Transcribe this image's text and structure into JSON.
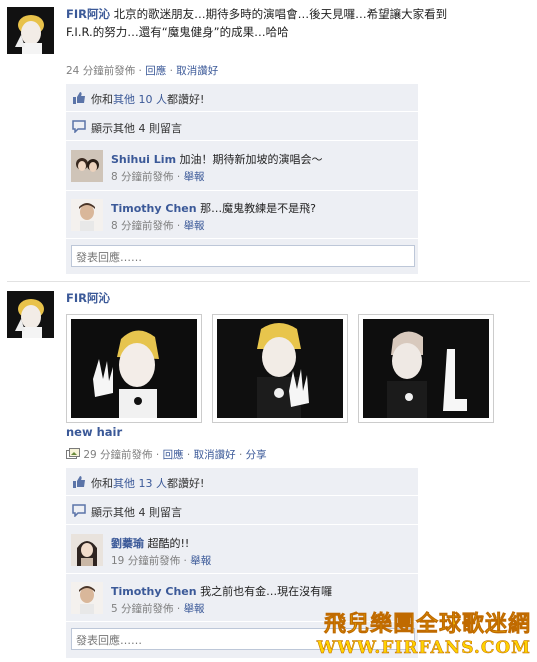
{
  "post1": {
    "author": "FIR阿沁",
    "text_line1": "北京的歌迷朋友…期待多時的演唱會…後天見囉…希望讓大家看到",
    "text_line2": "F.I.R.的努力…還有“魔鬼健身”的成果…哈哈",
    "time": "24 分鐘前發佈",
    "sep1": "·",
    "reply": "回應",
    "sep2": "·",
    "unlike": "取消讚好",
    "likes": {
      "prefix": "你和",
      "others": "其他",
      "count": "10 人",
      "suffix": "都讚好!"
    },
    "view_comments": {
      "label": "顯示其他",
      "count": "4 則留言"
    },
    "comments": [
      {
        "name": "Shihui Lim",
        "text": "加油！期待新加坡的演唱会～",
        "time": "8 分鐘前發佈",
        "sep": "·",
        "report": "舉報"
      },
      {
        "name": "Timothy Chen",
        "text": "那…魔鬼教練是不是飛?",
        "time": "8 分鐘前發佈",
        "sep": "·",
        "report": "舉報"
      }
    ],
    "reply_placeholder": "發表回應……"
  },
  "post2": {
    "author": "FIR阿沁",
    "caption": "new hair",
    "time": "29 分鐘前發佈",
    "sep1": "·",
    "reply": "回應",
    "sep2": "·",
    "unlike": "取消讚好",
    "sep3": "·",
    "share": "分享",
    "likes": {
      "prefix": "你和",
      "others": "其他",
      "count": "13 人",
      "suffix": "都讚好!"
    },
    "view_comments": {
      "label": "顯示其他",
      "count": "4 則留言"
    },
    "comments": [
      {
        "name": "劉蓁瑜",
        "text": "超酷的!!",
        "time": "19 分鐘前發佈",
        "sep": "·",
        "report": "舉報"
      },
      {
        "name": "Timothy Chen",
        "text": "我之前也有金…現在沒有囉",
        "time": "5 分鐘前發佈",
        "sep": "·",
        "report": "舉報"
      }
    ],
    "reply_placeholder": "發表回應……"
  },
  "watermark": {
    "line1": "飛兒樂團全球歌迷網",
    "line2": "WWW.FIRFANS.COM"
  },
  "colors": {
    "link": "#3b5998",
    "panel": "#edeff4",
    "meta": "#808080",
    "watermark": "#ffd200"
  },
  "icons": {
    "like": "thumbs-up-icon",
    "comment": "comment-bubble-icon",
    "photo": "photo-album-icon"
  }
}
